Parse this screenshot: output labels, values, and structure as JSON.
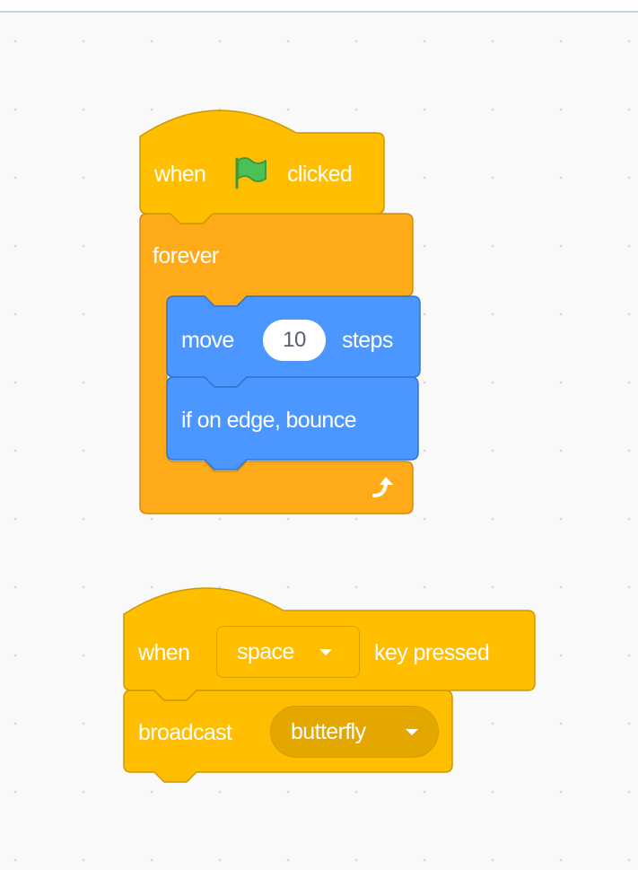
{
  "script1": {
    "hat": {
      "when_label": "when",
      "clicked_label": "clicked",
      "flag_icon": "green-flag-icon"
    },
    "forever": {
      "label": "forever",
      "loop_icon": "loop-arrow-icon"
    },
    "move": {
      "move_label": "move",
      "steps_value": "10",
      "steps_label": "steps"
    },
    "bounce": {
      "label": "if on edge, bounce"
    }
  },
  "script2": {
    "hat": {
      "when_label": "when",
      "key_value": "space",
      "pressed_label": "key pressed"
    },
    "broadcast": {
      "label": "broadcast",
      "message_value": "butterfly"
    }
  },
  "colors": {
    "events": "#ffbf00",
    "control": "#ffab19",
    "motion": "#4c97ff",
    "flag": "#4cbf56",
    "workspace": "#f9f9f9"
  }
}
